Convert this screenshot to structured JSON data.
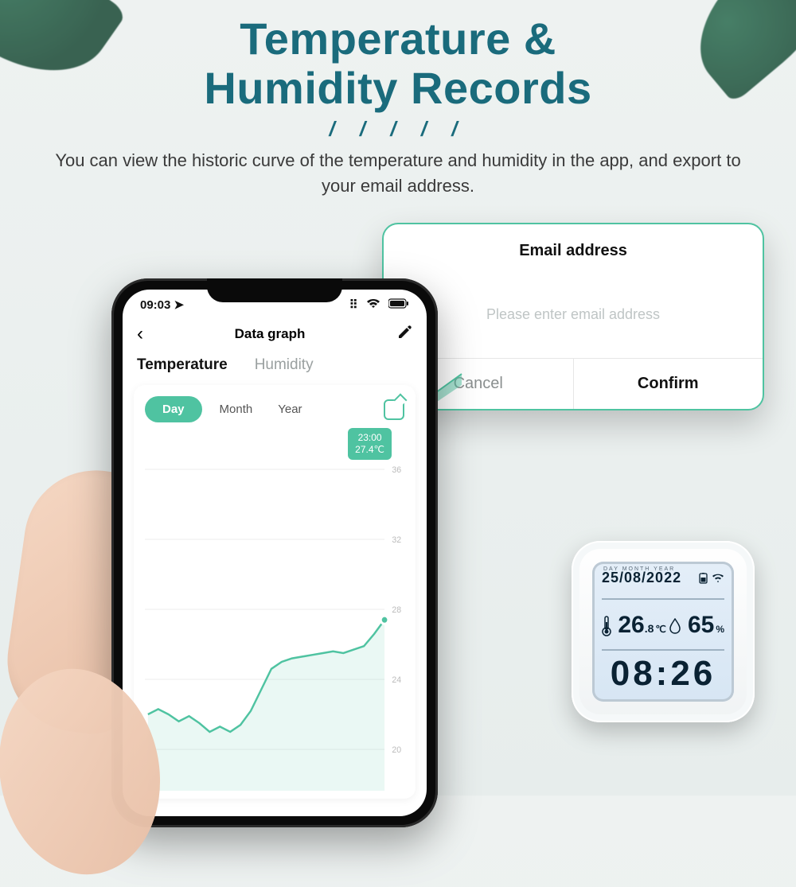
{
  "hero": {
    "title_line1": "Temperature &",
    "title_line2": "Humidity Records",
    "slashes": "/ / / / /",
    "subtitle": "You can view the historic curve of the temperature and  humidity in the app, and export to your email address."
  },
  "phone": {
    "status": {
      "time": "09:03",
      "nav": "◀",
      "signal": "⁞⁞⁞",
      "wifi": "◉",
      "battery": "▮"
    },
    "appbar": {
      "back": "‹",
      "title": "Data graph"
    },
    "tabs": {
      "temperature": "Temperature",
      "humidity": "Humidity"
    },
    "range": {
      "day": "Day",
      "month": "Month",
      "year": "Year"
    },
    "tooltip": {
      "time": "23:00",
      "value": "27.4℃"
    }
  },
  "popup": {
    "title": "Email address",
    "placeholder": "Please enter email address",
    "cancel": "Cancel",
    "confirm": "Confirm"
  },
  "device": {
    "labels": "DAY   MONTH   YEAR",
    "date": "25/08/2022",
    "temp_int": "26",
    "temp_dec": ".8",
    "temp_unit": "℃",
    "hum": "65",
    "hum_unit": "%",
    "clock": "08:26"
  },
  "chart_data": {
    "type": "line",
    "title": "Temperature – Day",
    "xlabel": "",
    "ylabel": "",
    "ylim": [
      18,
      36
    ],
    "y_ticks": [
      20,
      24,
      28,
      32,
      36
    ],
    "x": [
      0,
      1,
      2,
      3,
      4,
      5,
      6,
      7,
      8,
      9,
      10,
      11,
      12,
      13,
      14,
      15,
      16,
      17,
      18,
      19,
      20,
      21,
      22,
      23
    ],
    "values": [
      22.0,
      22.3,
      22.0,
      21.6,
      21.9,
      21.5,
      21.0,
      21.3,
      21.0,
      21.4,
      22.2,
      23.4,
      24.6,
      25.0,
      25.2,
      25.3,
      25.4,
      25.5,
      25.6,
      25.5,
      25.7,
      25.9,
      26.6,
      27.4
    ],
    "highlight": {
      "x": 23,
      "label_time": "23:00",
      "label_value": "27.4℃"
    }
  }
}
